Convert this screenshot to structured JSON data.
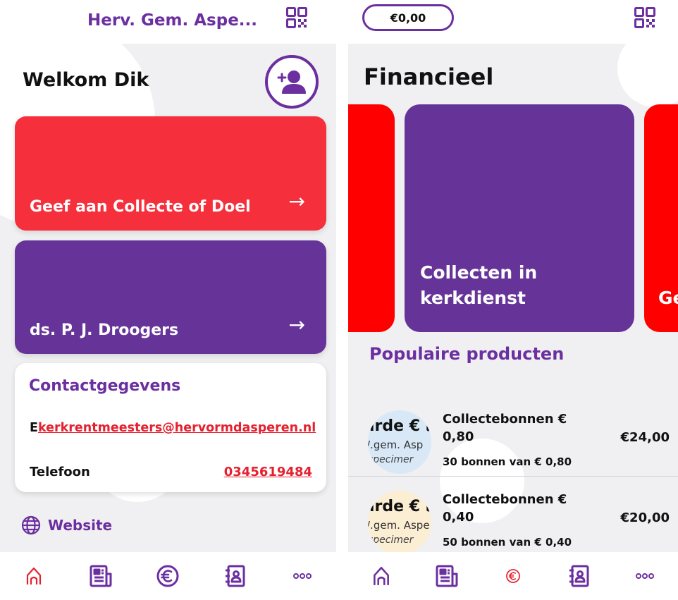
{
  "left_screen": {
    "header": {
      "church_name": "Herv. Gem. Aspe..."
    },
    "welcome": "Welkom Dik",
    "cards": [
      {
        "label": "Geef aan Collecte of Doel",
        "arrow": "→",
        "color": "#f52f3b"
      },
      {
        "label": "ds. P. J. Droogers",
        "arrow": "→",
        "color": "#663399"
      }
    ],
    "contact": {
      "title": "Contactgegevens",
      "email_prefix": "E",
      "email": "kerkrentmeesters@hervormdasperen.nl",
      "phone_label": "Telefoon",
      "phone": "0345619484"
    },
    "website_label": "Website",
    "nav_active": "home"
  },
  "right_screen": {
    "balance": "€0,00",
    "title": "Financieel",
    "carousel": [
      {
        "label": "",
        "color": "#ff0000"
      },
      {
        "label": "Collecten in kerkdienst",
        "color": "#663399"
      },
      {
        "label": "Ge",
        "color": "#ff0000"
      }
    ],
    "popular_title": "Populaire producten",
    "products": [
      {
        "thumb_line1": "ırde € ι",
        "thumb_line2": "/.gem. Asp",
        "thumb_line3": "specimer",
        "name": "Collectebonnen € 0,80",
        "description": "30 bonnen van € 0,80",
        "price": "€24,00",
        "thumb_bg": "#d8e8f6"
      },
      {
        "thumb_line1": "ırde € ι",
        "thumb_line2": "/.gem. Aspe",
        "thumb_line3": "specimer",
        "name": "Collectebonnen € 0,40",
        "description": "50 bonnen van € 0,40",
        "price": "€20,00",
        "thumb_bg": "#fbeed2"
      }
    ],
    "nav_active": "finance"
  },
  "colors": {
    "purple": "#6b2fa0",
    "red": "#e5212f"
  }
}
